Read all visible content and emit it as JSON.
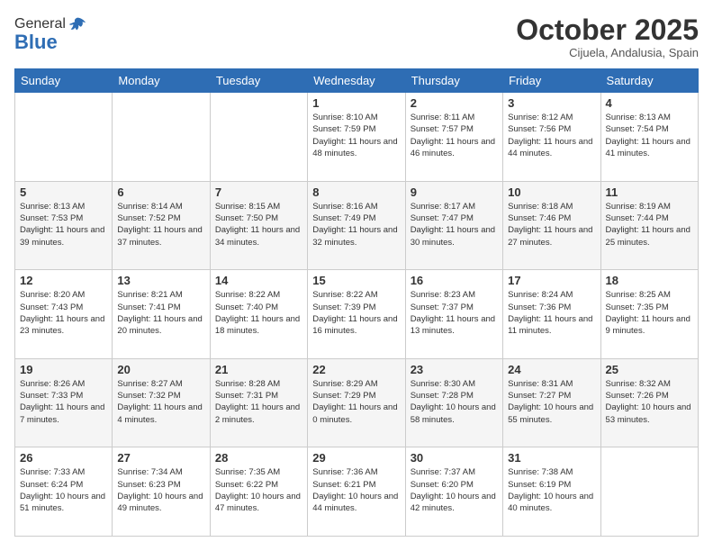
{
  "logo": {
    "general": "General",
    "blue": "Blue"
  },
  "header": {
    "month_title": "October 2025",
    "location": "Cijuela, Andalusia, Spain"
  },
  "weekdays": [
    "Sunday",
    "Monday",
    "Tuesday",
    "Wednesday",
    "Thursday",
    "Friday",
    "Saturday"
  ],
  "weeks": [
    [
      {
        "day": "",
        "info": ""
      },
      {
        "day": "",
        "info": ""
      },
      {
        "day": "",
        "info": ""
      },
      {
        "day": "1",
        "info": "Sunrise: 8:10 AM\nSunset: 7:59 PM\nDaylight: 11 hours\nand 48 minutes."
      },
      {
        "day": "2",
        "info": "Sunrise: 8:11 AM\nSunset: 7:57 PM\nDaylight: 11 hours\nand 46 minutes."
      },
      {
        "day": "3",
        "info": "Sunrise: 8:12 AM\nSunset: 7:56 PM\nDaylight: 11 hours\nand 44 minutes."
      },
      {
        "day": "4",
        "info": "Sunrise: 8:13 AM\nSunset: 7:54 PM\nDaylight: 11 hours\nand 41 minutes."
      }
    ],
    [
      {
        "day": "5",
        "info": "Sunrise: 8:13 AM\nSunset: 7:53 PM\nDaylight: 11 hours\nand 39 minutes."
      },
      {
        "day": "6",
        "info": "Sunrise: 8:14 AM\nSunset: 7:52 PM\nDaylight: 11 hours\nand 37 minutes."
      },
      {
        "day": "7",
        "info": "Sunrise: 8:15 AM\nSunset: 7:50 PM\nDaylight: 11 hours\nand 34 minutes."
      },
      {
        "day": "8",
        "info": "Sunrise: 8:16 AM\nSunset: 7:49 PM\nDaylight: 11 hours\nand 32 minutes."
      },
      {
        "day": "9",
        "info": "Sunrise: 8:17 AM\nSunset: 7:47 PM\nDaylight: 11 hours\nand 30 minutes."
      },
      {
        "day": "10",
        "info": "Sunrise: 8:18 AM\nSunset: 7:46 PM\nDaylight: 11 hours\nand 27 minutes."
      },
      {
        "day": "11",
        "info": "Sunrise: 8:19 AM\nSunset: 7:44 PM\nDaylight: 11 hours\nand 25 minutes."
      }
    ],
    [
      {
        "day": "12",
        "info": "Sunrise: 8:20 AM\nSunset: 7:43 PM\nDaylight: 11 hours\nand 23 minutes."
      },
      {
        "day": "13",
        "info": "Sunrise: 8:21 AM\nSunset: 7:41 PM\nDaylight: 11 hours\nand 20 minutes."
      },
      {
        "day": "14",
        "info": "Sunrise: 8:22 AM\nSunset: 7:40 PM\nDaylight: 11 hours\nand 18 minutes."
      },
      {
        "day": "15",
        "info": "Sunrise: 8:22 AM\nSunset: 7:39 PM\nDaylight: 11 hours\nand 16 minutes."
      },
      {
        "day": "16",
        "info": "Sunrise: 8:23 AM\nSunset: 7:37 PM\nDaylight: 11 hours\nand 13 minutes."
      },
      {
        "day": "17",
        "info": "Sunrise: 8:24 AM\nSunset: 7:36 PM\nDaylight: 11 hours\nand 11 minutes."
      },
      {
        "day": "18",
        "info": "Sunrise: 8:25 AM\nSunset: 7:35 PM\nDaylight: 11 hours\nand 9 minutes."
      }
    ],
    [
      {
        "day": "19",
        "info": "Sunrise: 8:26 AM\nSunset: 7:33 PM\nDaylight: 11 hours\nand 7 minutes."
      },
      {
        "day": "20",
        "info": "Sunrise: 8:27 AM\nSunset: 7:32 PM\nDaylight: 11 hours\nand 4 minutes."
      },
      {
        "day": "21",
        "info": "Sunrise: 8:28 AM\nSunset: 7:31 PM\nDaylight: 11 hours\nand 2 minutes."
      },
      {
        "day": "22",
        "info": "Sunrise: 8:29 AM\nSunset: 7:29 PM\nDaylight: 11 hours\nand 0 minutes."
      },
      {
        "day": "23",
        "info": "Sunrise: 8:30 AM\nSunset: 7:28 PM\nDaylight: 10 hours\nand 58 minutes."
      },
      {
        "day": "24",
        "info": "Sunrise: 8:31 AM\nSunset: 7:27 PM\nDaylight: 10 hours\nand 55 minutes."
      },
      {
        "day": "25",
        "info": "Sunrise: 8:32 AM\nSunset: 7:26 PM\nDaylight: 10 hours\nand 53 minutes."
      }
    ],
    [
      {
        "day": "26",
        "info": "Sunrise: 7:33 AM\nSunset: 6:24 PM\nDaylight: 10 hours\nand 51 minutes."
      },
      {
        "day": "27",
        "info": "Sunrise: 7:34 AM\nSunset: 6:23 PM\nDaylight: 10 hours\nand 49 minutes."
      },
      {
        "day": "28",
        "info": "Sunrise: 7:35 AM\nSunset: 6:22 PM\nDaylight: 10 hours\nand 47 minutes."
      },
      {
        "day": "29",
        "info": "Sunrise: 7:36 AM\nSunset: 6:21 PM\nDaylight: 10 hours\nand 44 minutes."
      },
      {
        "day": "30",
        "info": "Sunrise: 7:37 AM\nSunset: 6:20 PM\nDaylight: 10 hours\nand 42 minutes."
      },
      {
        "day": "31",
        "info": "Sunrise: 7:38 AM\nSunset: 6:19 PM\nDaylight: 10 hours\nand 40 minutes."
      },
      {
        "day": "",
        "info": ""
      }
    ]
  ]
}
